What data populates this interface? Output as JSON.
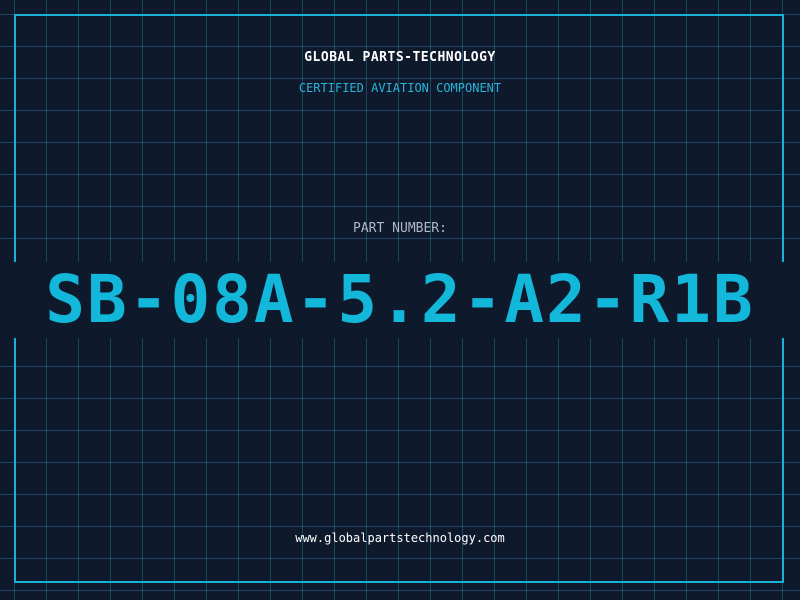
{
  "header": {
    "company_name": "GLOBAL PARTS-TECHNOLOGY",
    "subtitle": "CERTIFIED AVIATION COMPONENT"
  },
  "part": {
    "label": "PART NUMBER:",
    "number": "SB-08A-5.2-A2-R1B"
  },
  "footer": {
    "website": "www.globalpartstechnology.com"
  },
  "colors": {
    "background": "#0f192c",
    "grid": "#226e8c",
    "accent": "#12b7da",
    "frame": "#1bb0d8",
    "label": "#aeb8c8",
    "text": "#ffffff"
  }
}
